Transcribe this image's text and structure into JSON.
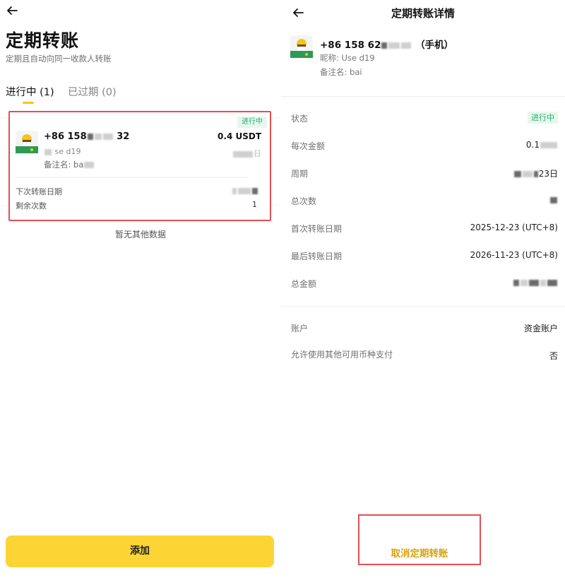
{
  "left": {
    "title": "定期转账",
    "subtitle": "定期且自动向同一收款人转账",
    "tabs": [
      {
        "label": "进行中 (1)",
        "active": true
      },
      {
        "label": "已过期 (0)",
        "active": false
      }
    ],
    "card": {
      "status": "进行中",
      "phone": "+86 158",
      "phone_tail": "32",
      "nickname": "se   d19",
      "remark": "备注名: ba",
      "amount": "0.4 USDT",
      "date_tail": "日",
      "next_date_label": "下次转账日期",
      "remaining_label": "剩余次数",
      "remaining_value": "1"
    },
    "empty_note": "暂无其他数据",
    "add_button": "添加"
  },
  "right": {
    "title": "定期转账详情",
    "phone": "+86 158 62",
    "phone_suffix": "（手机）",
    "nickname": "昵称: Use   d19",
    "remark": "备注名: bai",
    "rows": [
      {
        "label": "状态",
        "value": "进行中"
      },
      {
        "label": "每次金额",
        "value": "0.1"
      },
      {
        "label": "周期",
        "value": "23日"
      },
      {
        "label": "总次数",
        "value": ""
      },
      {
        "label": "首次转账日期",
        "value": "2025-12-23 (UTC+8)"
      },
      {
        "label": "最后转账日期",
        "value": "2026-11-23 (UTC+8)"
      },
      {
        "label": "总金额",
        "value": ""
      },
      {
        "label": "账户",
        "value": "资金账户"
      },
      {
        "label": "允许使用其他可用币种支付",
        "value": "否"
      }
    ],
    "cancel_button": "取消定期转账"
  },
  "colors": {
    "accent_yellow": "#fcd535",
    "status_green": "#20b26c",
    "highlight_red": "#e35050",
    "cancel_text": "#d9a310"
  }
}
